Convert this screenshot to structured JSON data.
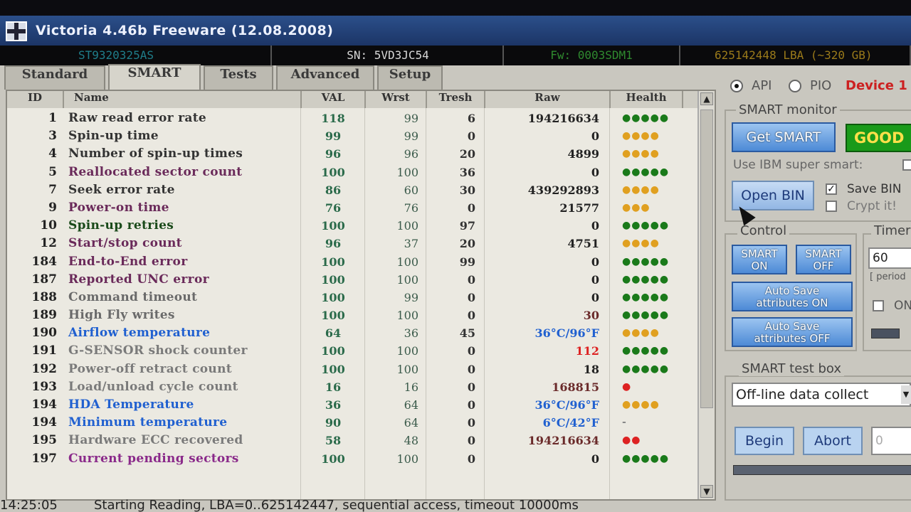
{
  "window": {
    "title": "Victoria 4.46b Freeware (12.08.2008)"
  },
  "info": {
    "model": "ST9320325AS",
    "serial": "SN: 5VD3JC54",
    "firmware": "Fw: 0003SDM1",
    "lba": "625142448 LBA (~320 GB)"
  },
  "tabs": [
    "Standard",
    "SMART",
    "Tests",
    "Advanced",
    "Setup"
  ],
  "mode": {
    "api": "API",
    "pio": "PIO",
    "device": "Device 1"
  },
  "table": {
    "headers": {
      "id": "ID",
      "name": "Name",
      "val": "VAL",
      "wrst": "Wrst",
      "tresh": "Tresh",
      "raw": "Raw",
      "health": "Health"
    },
    "rows": [
      {
        "id": "1",
        "name": "Raw read error rate",
        "val": "118",
        "wrst": "99",
        "tresh": "6",
        "raw": "194216634",
        "health": "●●●●●",
        "name_color": "#333333",
        "raw_color": "#222222",
        "health_color": "#1a7a1a"
      },
      {
        "id": "3",
        "name": "Spin-up time",
        "val": "99",
        "wrst": "99",
        "tresh": "0",
        "raw": "0",
        "health": "●●●●",
        "name_color": "#333333",
        "raw_color": "#222222",
        "health_color": "#e0a020"
      },
      {
        "id": "4",
        "name": "Number of spin-up times",
        "val": "96",
        "wrst": "96",
        "tresh": "20",
        "raw": "4899",
        "health": "●●●●",
        "name_color": "#333333",
        "raw_color": "#222222",
        "health_color": "#e0a020"
      },
      {
        "id": "5",
        "name": "Reallocated sector count",
        "val": "100",
        "wrst": "100",
        "tresh": "36",
        "raw": "0",
        "health": "●●●●●",
        "name_color": "#6a2a5a",
        "raw_color": "#222222",
        "health_color": "#1a7a1a"
      },
      {
        "id": "7",
        "name": "Seek error rate",
        "val": "86",
        "wrst": "60",
        "tresh": "30",
        "raw": "439292893",
        "health": "●●●●",
        "name_color": "#333333",
        "raw_color": "#222222",
        "health_color": "#e0a020"
      },
      {
        "id": "9",
        "name": "Power-on time",
        "val": "76",
        "wrst": "76",
        "tresh": "0",
        "raw": "21577",
        "health": "●●●",
        "name_color": "#6a2a5a",
        "raw_color": "#222222",
        "health_color": "#e0a020"
      },
      {
        "id": "10",
        "name": "Spin-up retries",
        "val": "100",
        "wrst": "100",
        "tresh": "97",
        "raw": "0",
        "health": "●●●●●",
        "name_color": "#1a4a1a",
        "raw_color": "#222222",
        "health_color": "#1a7a1a"
      },
      {
        "id": "12",
        "name": "Start/stop count",
        "val": "96",
        "wrst": "37",
        "tresh": "20",
        "raw": "4751",
        "health": "●●●●",
        "name_color": "#6a2a5a",
        "raw_color": "#222222",
        "health_color": "#e0a020"
      },
      {
        "id": "184",
        "name": "End-to-End error",
        "val": "100",
        "wrst": "100",
        "tresh": "99",
        "raw": "0",
        "health": "●●●●●",
        "name_color": "#6a2a5a",
        "raw_color": "#222222",
        "health_color": "#1a7a1a"
      },
      {
        "id": "187",
        "name": "Reported UNC error",
        "val": "100",
        "wrst": "100",
        "tresh": "0",
        "raw": "0",
        "health": "●●●●●",
        "name_color": "#6a2a5a",
        "raw_color": "#222222",
        "health_color": "#1a7a1a"
      },
      {
        "id": "188",
        "name": "Command timeout",
        "val": "100",
        "wrst": "99",
        "tresh": "0",
        "raw": "0",
        "health": "●●●●●",
        "name_color": "#6a6a6a",
        "raw_color": "#222222",
        "health_color": "#1a7a1a"
      },
      {
        "id": "189",
        "name": "High Fly writes",
        "val": "100",
        "wrst": "100",
        "tresh": "0",
        "raw": "30",
        "health": "●●●●●",
        "name_color": "#6a6a6a",
        "raw_color": "#6a2a2a",
        "health_color": "#1a7a1a"
      },
      {
        "id": "190",
        "name": "Airflow temperature",
        "val": "64",
        "wrst": "36",
        "tresh": "45",
        "raw": "36°C/96°F",
        "health": "●●●●",
        "name_color": "#2060d0",
        "raw_color": "#2060d0",
        "health_color": "#e0a020"
      },
      {
        "id": "191",
        "name": "G-SENSOR shock counter",
        "val": "100",
        "wrst": "100",
        "tresh": "0",
        "raw": "112",
        "health": "●●●●●",
        "name_color": "#7a7a7a",
        "raw_color": "#dd2222",
        "health_color": "#1a7a1a"
      },
      {
        "id": "192",
        "name": "Power-off retract count",
        "val": "100",
        "wrst": "100",
        "tresh": "0",
        "raw": "18",
        "health": "●●●●●",
        "name_color": "#7a7a7a",
        "raw_color": "#222222",
        "health_color": "#1a7a1a"
      },
      {
        "id": "193",
        "name": "Load/unload cycle count",
        "val": "16",
        "wrst": "16",
        "tresh": "0",
        "raw": "168815",
        "health": "●",
        "name_color": "#7a7a7a",
        "raw_color": "#6a2a2a",
        "health_color": "#dd2222"
      },
      {
        "id": "194",
        "name": "HDA Temperature",
        "val": "36",
        "wrst": "64",
        "tresh": "0",
        "raw": "36°C/96°F",
        "health": "●●●●",
        "name_color": "#2060d0",
        "raw_color": "#2060d0",
        "health_color": "#e0a020"
      },
      {
        "id": "194",
        "name": "Minimum temperature",
        "val": "90",
        "wrst": "64",
        "tresh": "0",
        "raw": "6°C/42°F",
        "health": "-",
        "name_color": "#2060d0",
        "raw_color": "#2060d0",
        "health_color": "#888888"
      },
      {
        "id": "195",
        "name": "Hardware ECC recovered",
        "val": "58",
        "wrst": "48",
        "tresh": "0",
        "raw": "194216634",
        "health": "●●",
        "name_color": "#7a7a7a",
        "raw_color": "#6a2a2a",
        "health_color": "#dd2222"
      },
      {
        "id": "197",
        "name": "Current pending sectors",
        "val": "100",
        "wrst": "100",
        "tresh": "0",
        "raw": "0",
        "health": "●●●●●",
        "name_color": "#8a2a8a",
        "raw_color": "#222222",
        "health_color": "#1a7a1a"
      }
    ]
  },
  "smart_monitor": {
    "title": "SMART monitor",
    "get_smart": "Get SMART",
    "status": "GOOD",
    "status_color": "#1a9a1a",
    "ibm_label": "Use IBM super smart:",
    "open_bin": "Open BIN",
    "save_bin": "Save BIN",
    "crypt": "Crypt it!"
  },
  "control": {
    "title": "Control",
    "smart_on": "SMART ON",
    "smart_off": "SMART OFF",
    "autosave_on": "Auto Save attributes ON",
    "autosave_off": "Auto Save attributes OFF"
  },
  "timer": {
    "title": "Timer",
    "value": "60",
    "period": "[ period",
    "on_label": "ON"
  },
  "test_box": {
    "title": "SMART test box",
    "selected": "Off-line data collect",
    "begin": "Begin",
    "abort": "Abort",
    "value": "0"
  },
  "status": {
    "time": "14:25:05",
    "text": "Starting Reading, LBA=0..625142447, sequential access, timeout 10000ms"
  }
}
